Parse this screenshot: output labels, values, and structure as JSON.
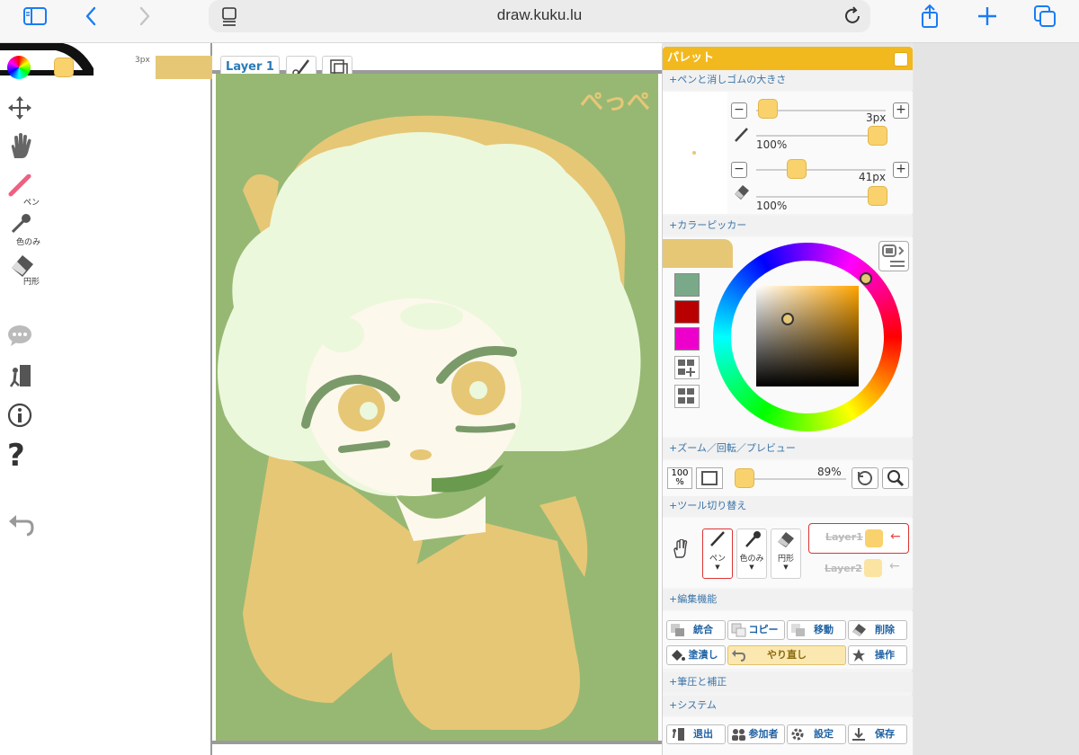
{
  "browser": {
    "url": "draw.kuku.lu"
  },
  "toolbar_left": {
    "pen_label": "ペン",
    "eyedropper_label": "色のみ",
    "shape_label": "円形",
    "pen_size_label": "3px"
  },
  "layer_bar": {
    "layer_label": "Layer 1"
  },
  "canvas": {
    "signature": "ぺっぺ",
    "background_color": "#97b873"
  },
  "palette": {
    "title": "パレット",
    "sections": {
      "pen_size": "+ペンと消しゴムの大きさ",
      "color_picker": "+カラーピッカー",
      "zoom": "+ズーム／回転／プレビュー",
      "tool_switch": "+ツール切り替え",
      "edit": "+編集機能",
      "pressure": "+筆圧と補正",
      "system": "+システム"
    },
    "pen": {
      "size": "3px",
      "opacity": "100%"
    },
    "eraser": {
      "size": "41px",
      "opacity": "100%"
    },
    "zoom": {
      "label": "100\n%",
      "value": "89%"
    },
    "tools": {
      "pen": "ペン",
      "eyedropper": "色のみ",
      "shape": "円形",
      "layer1": "Layer1",
      "layer2": "Layer2"
    },
    "edit_buttons": {
      "merge": "統合",
      "copy": "コピー",
      "move": "移動",
      "delete": "削除",
      "fill": "塗潰し",
      "redo": "やり直し",
      "operation": "操作"
    },
    "system_buttons": {
      "exit": "退出",
      "participants": "参加者",
      "settings": "設定",
      "save": "保存"
    },
    "swatches": [
      "#7aa98a",
      "#b80000",
      "#ee00cc"
    ]
  },
  "colors": {
    "accent": "#f2b91f",
    "current_color": "#e6c776",
    "link_blue": "#2a7ab8"
  }
}
